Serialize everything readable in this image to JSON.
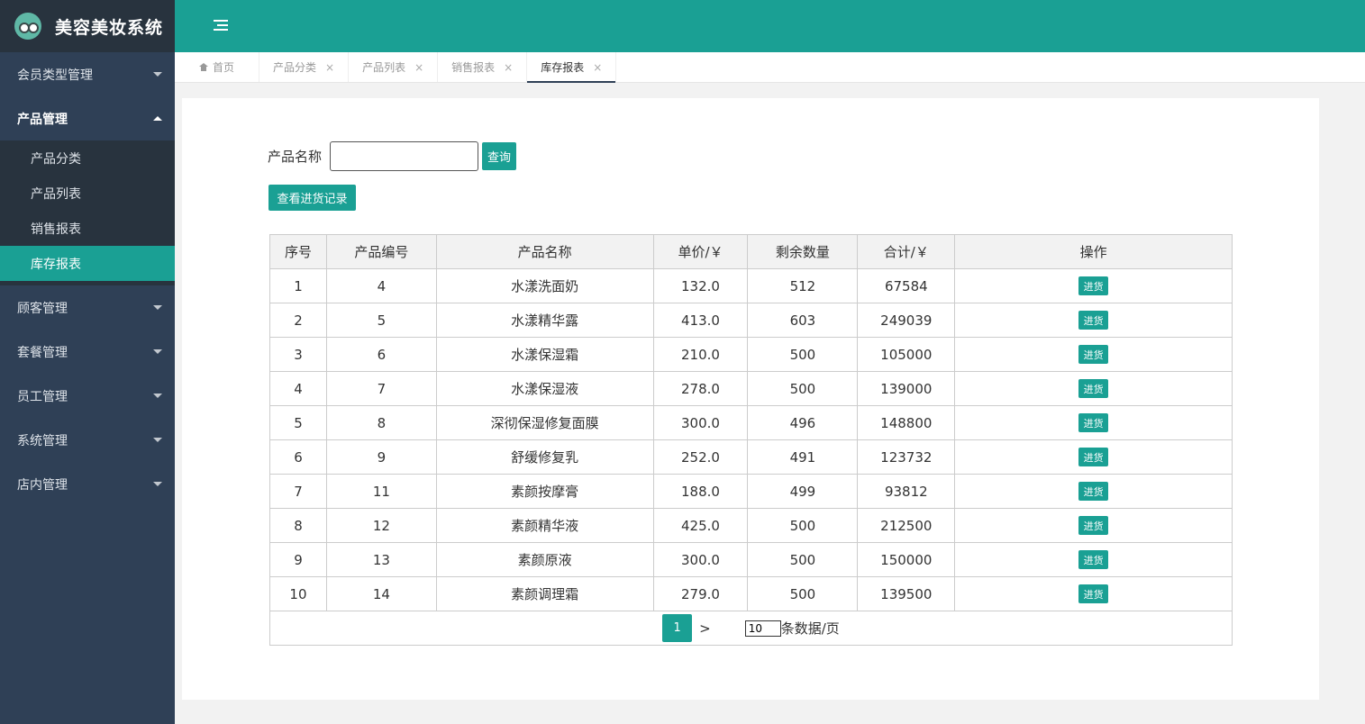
{
  "brand": {
    "title": "美容美妆系统"
  },
  "sidebar": {
    "items": [
      {
        "label": "会员类型管理"
      },
      {
        "label": "产品管理",
        "children": [
          "产品分类",
          "产品列表",
          "销售报表",
          "库存报表"
        ]
      },
      {
        "label": "顾客管理"
      },
      {
        "label": "套餐管理"
      },
      {
        "label": "员工管理"
      },
      {
        "label": "系统管理"
      },
      {
        "label": "店内管理"
      }
    ]
  },
  "tabs": [
    "首页",
    "产品分类",
    "产品列表",
    "销售报表",
    "库存报表"
  ],
  "tab_close": "×",
  "search": {
    "label": "产品名称",
    "value": "",
    "button": "查询"
  },
  "record_button": "查看进货记录",
  "table": {
    "headers": [
      "序号",
      "产品编号",
      "产品名称",
      "单价/￥",
      "剩余数量",
      "合计/￥",
      "操作"
    ],
    "action_label": "进货",
    "rows": [
      [
        "1",
        "4",
        "水漾洗面奶",
        "132.0",
        "512",
        "67584"
      ],
      [
        "2",
        "5",
        "水漾精华露",
        "413.0",
        "603",
        "249039"
      ],
      [
        "3",
        "6",
        "水漾保湿霜",
        "210.0",
        "500",
        "105000"
      ],
      [
        "4",
        "7",
        "水漾保湿液",
        "278.0",
        "500",
        "139000"
      ],
      [
        "5",
        "8",
        "深彻保湿修复面膜",
        "300.0",
        "496",
        "148800"
      ],
      [
        "6",
        "9",
        "舒缓修复乳",
        "252.0",
        "491",
        "123732"
      ],
      [
        "7",
        "11",
        "素颜按摩膏",
        "188.0",
        "499",
        "93812"
      ],
      [
        "8",
        "12",
        "素颜精华液",
        "425.0",
        "500",
        "212500"
      ],
      [
        "9",
        "13",
        "素颜原液",
        "300.0",
        "500",
        "150000"
      ],
      [
        "10",
        "14",
        "素颜调理霜",
        "279.0",
        "500",
        "139500"
      ]
    ]
  },
  "pager": {
    "current": "1",
    "next": ">",
    "page_size": "10",
    "page_size_label": "条数据/页"
  },
  "colors": {
    "accent": "#1aa094",
    "sidebar": "#2f4056",
    "sidebar_dark": "#28333e"
  }
}
